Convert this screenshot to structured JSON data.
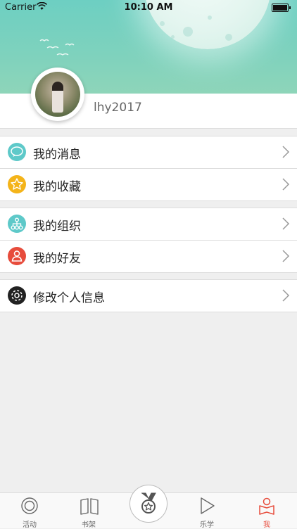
{
  "status_bar": {
    "carrier": "Carrier",
    "time": "10:10 AM"
  },
  "profile": {
    "username": "lhy2017"
  },
  "menu_groups": [
    {
      "items": [
        {
          "label": "我的消息",
          "icon": "message-bubble-icon",
          "color": "#5ec9c9"
        },
        {
          "label": "我的收藏",
          "icon": "star-icon",
          "color": "#f4b41a"
        }
      ]
    },
    {
      "items": [
        {
          "label": "我的组织",
          "icon": "organization-icon",
          "color": "#5ec9c9"
        },
        {
          "label": "我的好友",
          "icon": "friend-icon",
          "color": "#e74c3c"
        }
      ]
    },
    {
      "items": [
        {
          "label": "修改个人信息",
          "icon": "gear-icon",
          "color": "#222222"
        }
      ]
    }
  ],
  "tabbar": {
    "tabs": [
      {
        "label": "活动",
        "icon": "activity-icon"
      },
      {
        "label": "书架",
        "icon": "book-icon"
      },
      {
        "label": "",
        "icon": "medal-icon"
      },
      {
        "label": "乐学",
        "icon": "play-icon"
      },
      {
        "label": "我",
        "icon": "profile-icon"
      }
    ],
    "active_color": "#e74c3c"
  }
}
